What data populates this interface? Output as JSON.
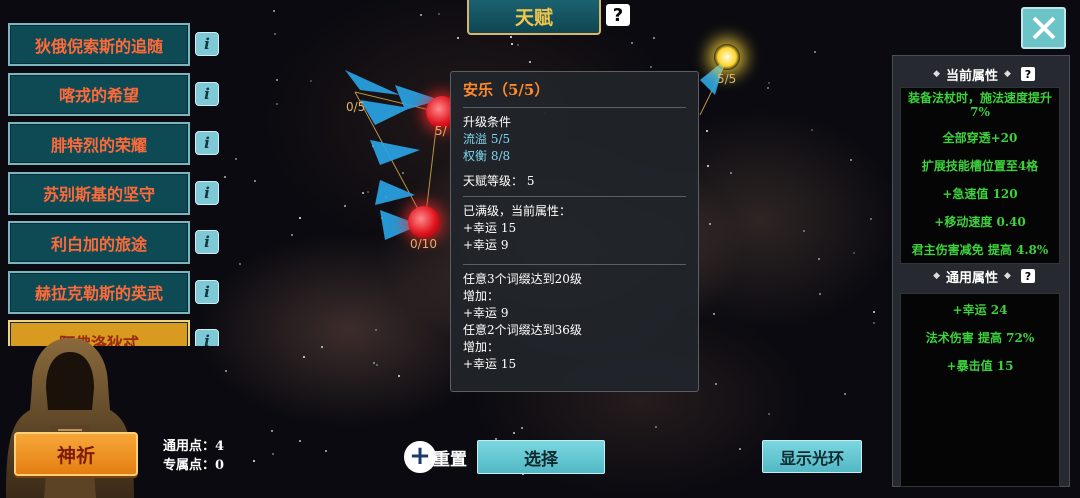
{
  "header": {
    "title": "天赋",
    "help_icon": "question-icon"
  },
  "close": {
    "icon": "close-x-icon"
  },
  "left_list": {
    "items": [
      {
        "label": "狄俄倪索斯的追随",
        "info": "i"
      },
      {
        "label": "喀戎的希望",
        "info": "i"
      },
      {
        "label": "腓特烈的荣耀",
        "info": "i"
      },
      {
        "label": "苏别斯基的坚守",
        "info": "i"
      },
      {
        "label": "利白加的旅途",
        "info": "i"
      },
      {
        "label": "赫拉克勒斯的英武",
        "info": "i"
      }
    ],
    "active_partial": {
      "label": "阿佛洛狄忒",
      "info": "i"
    }
  },
  "pray_button": "神祈",
  "points": {
    "general_label": "通用点：",
    "general_value": "4",
    "special_label": "专属点：",
    "special_value": "0"
  },
  "tree": {
    "labels": [
      "0/5",
      "5/",
      "0/10",
      "5/5"
    ]
  },
  "tooltip": {
    "title": "安乐（5/5）",
    "upgrade_header": "升级条件",
    "conditions": [
      "流溢  5/5",
      "权衡  8/8"
    ],
    "level_line": "天赋等级：  5",
    "maxed_header": "已满级，当前属性：",
    "current": [
      "+幸运  15",
      "+幸运  9"
    ],
    "bonus1_header": "任意3个词缀达到20级",
    "bonus1_add": "增加：",
    "bonus1_value": "+幸运  9",
    "bonus2_header": "任意2个词缀达到36级",
    "bonus2_add": "增加：",
    "bonus2_value": "+幸运  15"
  },
  "bottom": {
    "reset": "重置",
    "select": "选择",
    "halo": "显示光环"
  },
  "right_panel": {
    "current_title": "当前属性",
    "current_items": [
      "装备法杖时，施法速度提升7%",
      "全部穿透+20",
      "扩展技能槽位置至4格",
      "+急速值  120",
      "+移动速度  0.40",
      "君主伤害减免  提高  4.8%"
    ],
    "general_title": "通用属性",
    "general_items": [
      "+幸运  24",
      "法术伤害  提高  72%",
      "+暴击值  15"
    ]
  },
  "colors": {
    "accent_gold": "#f0c64c",
    "panel_green": "#3dd13d",
    "button_teal": "#0d4a54",
    "node_red": "#e0141e"
  }
}
